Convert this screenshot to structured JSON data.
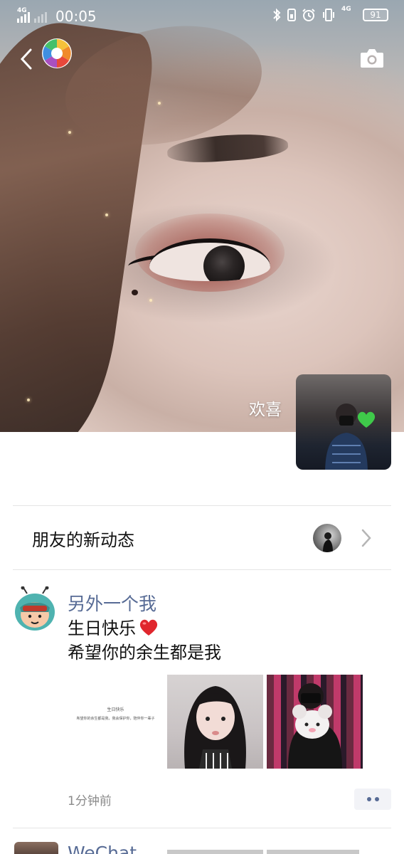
{
  "status_bar": {
    "network_left": "4G",
    "time": "00:05",
    "network_right": "4G",
    "battery": "91"
  },
  "profile": {
    "username": "欢喜"
  },
  "friends_updates": {
    "label": "朋友的新动态"
  },
  "post": {
    "author": "另外一个我",
    "line1": "生日快乐",
    "line2": "希望你的余生都是我",
    "image1_title": "生日快乐",
    "image1_caption": "希望你的余生都是我，我会保护你，陪伴你一辈子",
    "time": "1分钟前"
  },
  "next_post": {
    "author": "WeChat"
  },
  "colors": {
    "link_name": "#576b95",
    "divider": "#e5e5e5",
    "more_button_bg": "#f2f3f7"
  }
}
